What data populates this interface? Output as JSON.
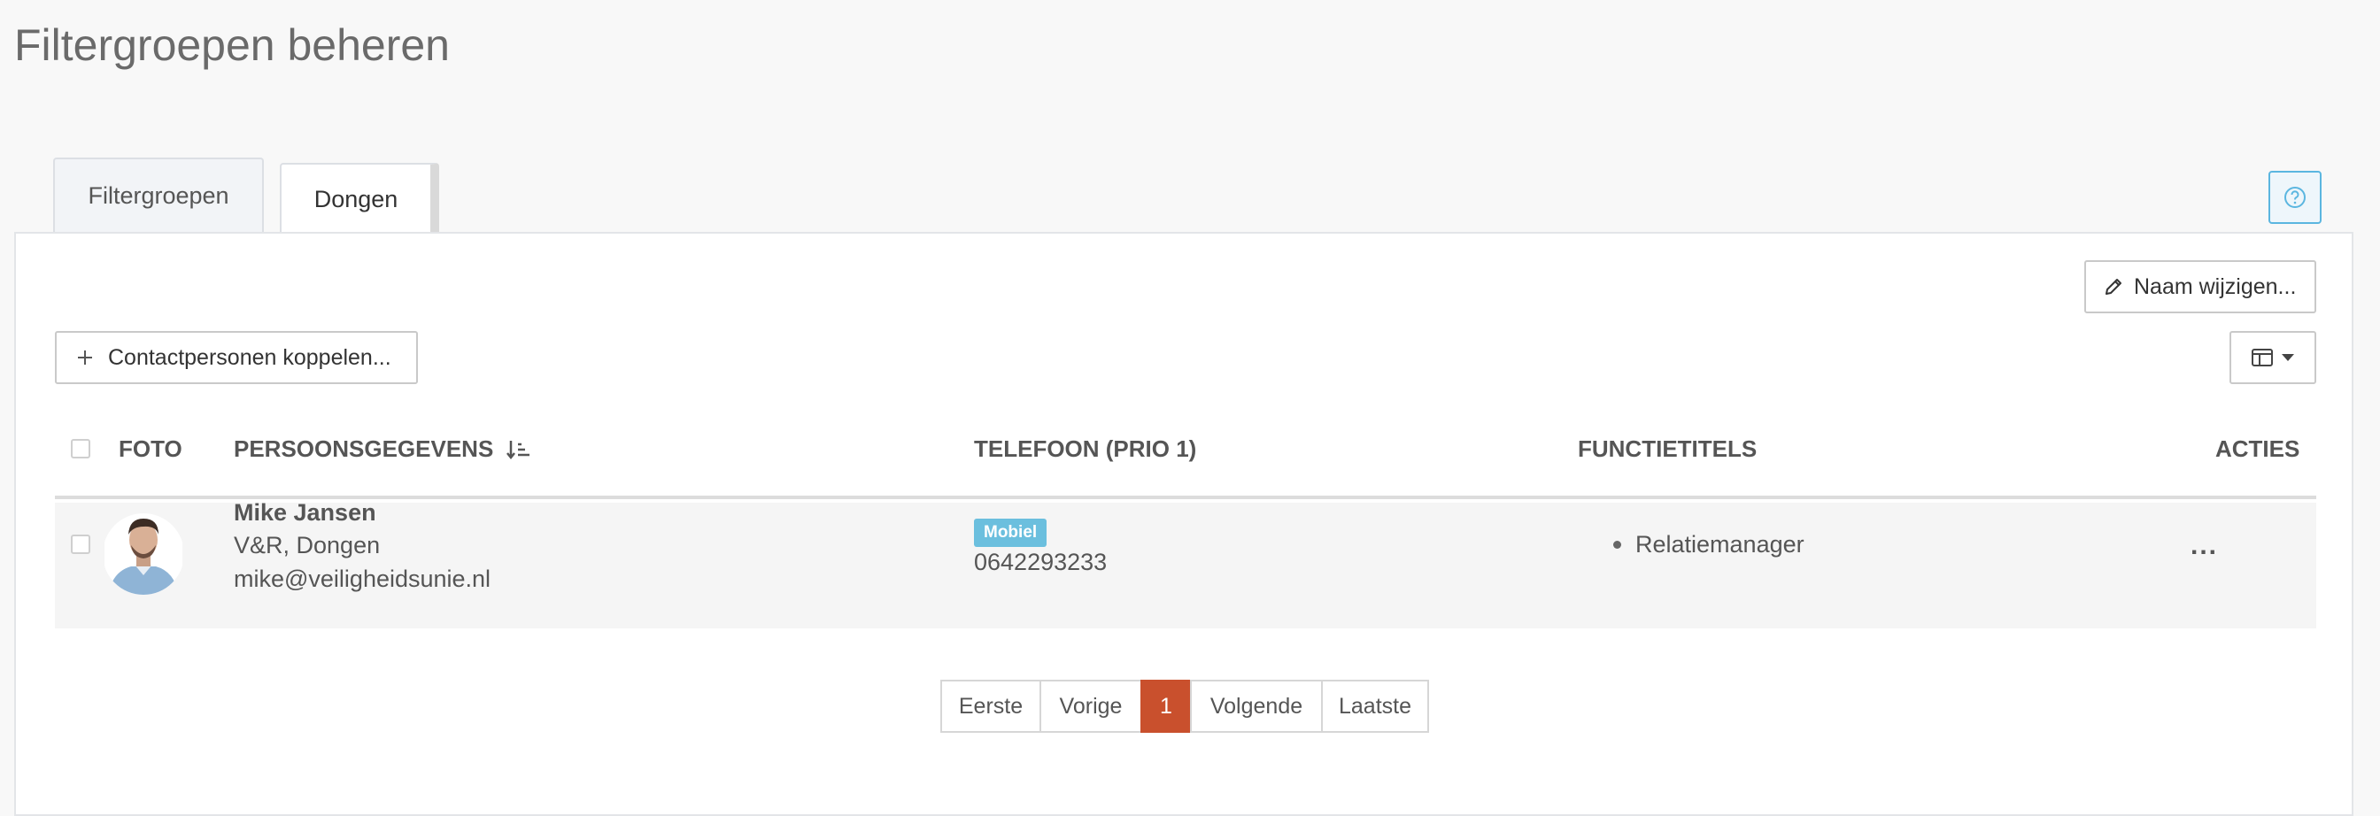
{
  "page": {
    "title": "Filtergroepen beheren"
  },
  "tabs": [
    {
      "label": "Filtergroepen"
    },
    {
      "label": "Dongen"
    }
  ],
  "toolbar": {
    "rename_label": "Naam wijzigen...",
    "link_contacts_label": "Contactpersonen koppelen..."
  },
  "table": {
    "columns": {
      "photo": "FOTO",
      "person": "PERSOONSGEGEVENS",
      "phone": "TELEFOON (PRIO 1)",
      "functions": "FUNCTIETITELS",
      "actions": "ACTIES"
    },
    "sort": {
      "column": "person",
      "direction": "ascending"
    },
    "rows": [
      {
        "name": "Mike Jansen",
        "organization": "V&R, Dongen",
        "email": "mike@veiligheidsunie.nl",
        "phone_type": "Mobiel",
        "phone": "0642293233",
        "functions": [
          "Relatiemanager"
        ],
        "actions": "..."
      }
    ]
  },
  "pagination": {
    "first": "Eerste",
    "prev": "Vorige",
    "current": "1",
    "next": "Volgende",
    "last": "Laatste"
  },
  "colors": {
    "accent": "#c9502d",
    "badge": "#6bbfde",
    "help": "#5bb6e0"
  },
  "icons": [
    "help-icon",
    "pencil-icon",
    "plus-icon",
    "columns-icon",
    "caret-down-icon",
    "sort-ascending-icon",
    "more-icon"
  ]
}
